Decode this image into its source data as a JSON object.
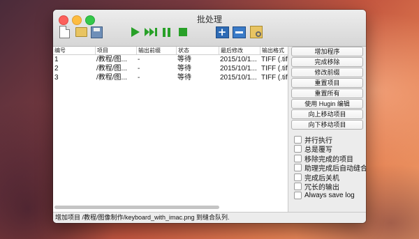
{
  "window": {
    "title": "批处理"
  },
  "toolbar": {
    "icons": [
      "new-document-icon",
      "open-folder-icon",
      "save-disk-icon",
      "play-icon",
      "fast-forward-icon",
      "pause-icon",
      "stop-icon",
      "add-icon",
      "remove-icon",
      "settings-icon"
    ]
  },
  "table": {
    "columns": [
      "编号",
      "项目",
      "输出前缀",
      "状态",
      "最后修改",
      "输出格式"
    ],
    "rows": [
      [
        "1",
        "/教程/图...",
        "-",
        "等待",
        "2015/10/1...",
        "TIFF (.tif"
      ],
      [
        "2",
        "/教程/图...",
        "-",
        "等待",
        "2015/10/1...",
        "TIFF (.tif"
      ],
      [
        "3",
        "/教程/图...",
        "-",
        "等待",
        "2015/10/1...",
        "TIFF (.tif"
      ]
    ]
  },
  "sidebar": {
    "buttons": [
      "增加程序",
      "完成移除",
      "修改前缀",
      "重置项目",
      "重置所有",
      "使用 Hugin 编辑",
      "向上移动项目",
      "向下移动项目"
    ],
    "checkboxes": [
      "并行执行",
      "总是覆写",
      "移除完成的项目",
      "助理完成后自动缝合",
      "完成后关机",
      "冗长的输出",
      "Always save log"
    ]
  },
  "status": {
    "text": "增加项目 /教程/图像制作/keyboard_with_imac.png 到缝合队列."
  }
}
